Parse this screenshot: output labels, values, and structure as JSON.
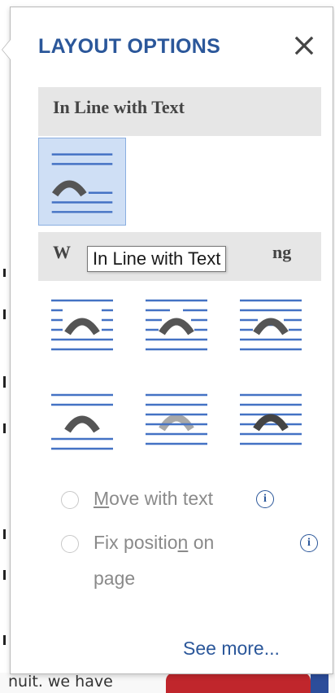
{
  "panel": {
    "title": "LAYOUT OPTIONS",
    "close_icon": "close-icon",
    "accent_color": "#2b579a"
  },
  "sections": [
    {
      "label": "In Line with Text",
      "options": [
        "inline-with-text"
      ]
    },
    {
      "label": "With Text Wrapping",
      "visible_label": "W",
      "visible_label_end": "ng",
      "options": [
        "square",
        "tight",
        "through",
        "top-and-bottom",
        "behind-text",
        "in-front-of-text"
      ]
    }
  ],
  "tooltip": {
    "text": "In Line with Text"
  },
  "radio_options": [
    {
      "label_pre": "",
      "label_underline": "M",
      "label_post": "ove with text",
      "checked": false,
      "has_info": true
    },
    {
      "label_pre": "Fix positio",
      "label_underline": "n",
      "label_post": " on",
      "label_line2": "page",
      "checked": false,
      "has_info": true
    }
  ],
  "info_glyph": "i",
  "link": {
    "see_more": "See more..."
  },
  "background": {
    "bottom_text": "nuit. we have"
  }
}
